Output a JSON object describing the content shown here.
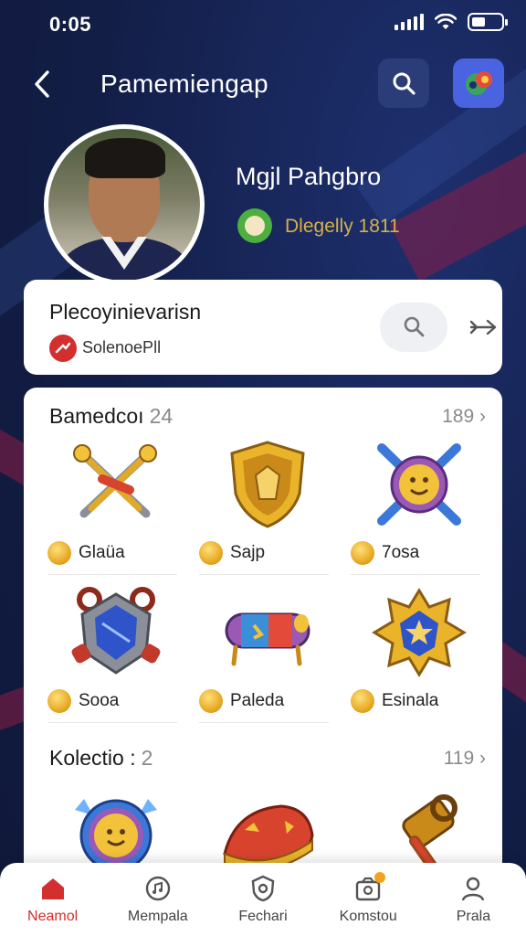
{
  "status_bar": {
    "time": "0:05"
  },
  "header": {
    "title": "Pamemiengap"
  },
  "profile": {
    "name": "Mgjl Pahgbro",
    "level_text": "Dlegelly 1811"
  },
  "info_card": {
    "label": "Plecoyinievarisn",
    "sub_label": "SolenoePll"
  },
  "badges_section": {
    "title": "Bamedcoı",
    "count": "24",
    "more": "189 ›",
    "items": [
      {
        "name": "Glaüa",
        "icon": "crossed-axes-icon"
      },
      {
        "name": "Sajp",
        "icon": "golden-shield-icon"
      },
      {
        "name": "7osa",
        "icon": "smiley-emblem-icon"
      },
      {
        "name": "Sooa",
        "icon": "gem-crest-icon"
      },
      {
        "name": "Paleda",
        "icon": "scroll-icon"
      },
      {
        "name": "Esinala",
        "icon": "star-badge-icon"
      }
    ]
  },
  "collection_section": {
    "title": "Kolectio :",
    "count": "2",
    "more": "119 ›",
    "items": [
      {
        "icon": "star-medal-icon"
      },
      {
        "icon": "red-hat-icon"
      },
      {
        "icon": "hammer-icon"
      }
    ]
  },
  "bottom_nav": [
    {
      "label": "Neamol",
      "icon": "home-icon",
      "active": true
    },
    {
      "label": "Mempala",
      "icon": "music-disc-icon",
      "active": false
    },
    {
      "label": "Fechari",
      "icon": "shield-gear-icon",
      "active": false
    },
    {
      "label": "Komstou",
      "icon": "inbox-icon",
      "active": false
    },
    {
      "label": "Prala",
      "icon": "profile-icon",
      "active": false
    }
  ],
  "colors": {
    "background": "#13204a",
    "accent": "#d32f2f",
    "header_app_button": "#4a63e0",
    "level_text": "#d6b04a"
  }
}
